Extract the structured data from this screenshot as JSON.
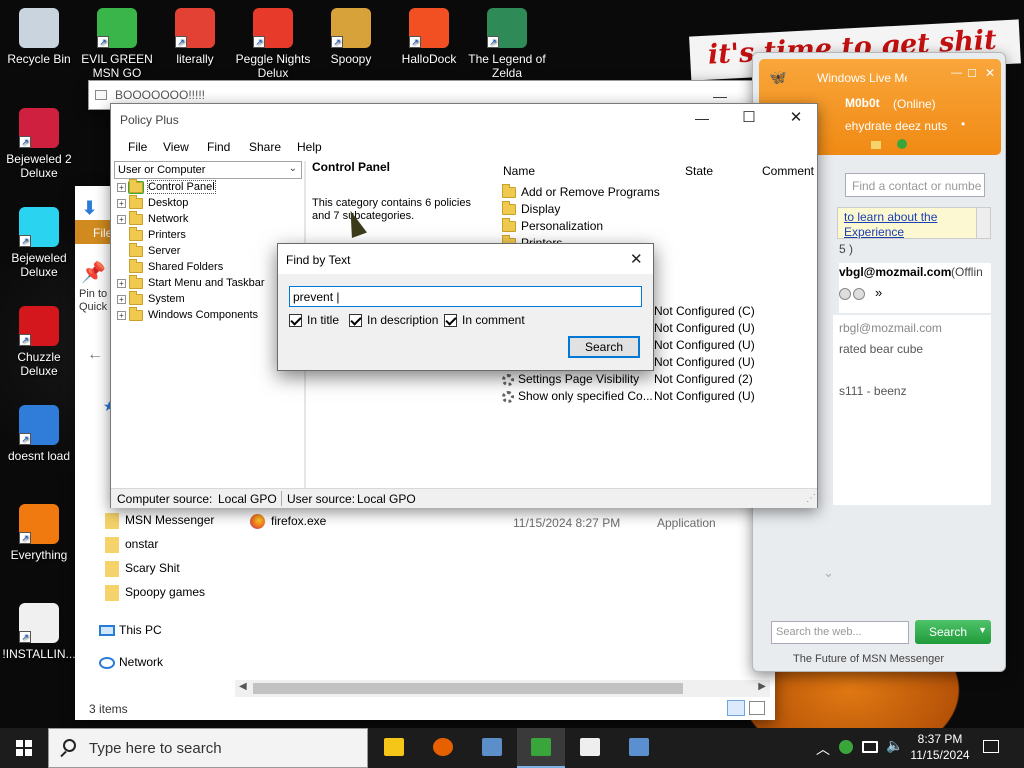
{
  "desktop_icons": [
    {
      "label": "Recycle Bin",
      "icon": "recycle-bin-icon",
      "color": "#c9d4de"
    },
    {
      "label": "EVIL GREEN MSN GO",
      "icon": "msn-buddy-icon",
      "color": "#39b54a"
    },
    {
      "label": "literally",
      "icon": "chrome-icon",
      "color": "#e34133"
    },
    {
      "label": "Peggle Nights Delux",
      "icon": "peggle-icon",
      "color": "#e83a2a"
    },
    {
      "label": "Spoopy",
      "icon": "spoopy-folder-icon",
      "color": "#d8a23b"
    },
    {
      "label": "HalloDock",
      "icon": "windows-logo-icon",
      "color": "#f25022"
    },
    {
      "label": "The Legend of Zelda",
      "icon": "zelda-icon",
      "color": "#2e8b57"
    },
    {
      "label": "Bejeweled 2 Deluxe",
      "icon": "bejeweled2-icon",
      "color": "#d02040"
    },
    {
      "label": "Bejeweled Deluxe",
      "icon": "bejeweled-icon",
      "color": "#2ad4f0"
    },
    {
      "label": "Chuzzle Deluxe",
      "icon": "chuzzle-icon",
      "color": "#d3171d"
    },
    {
      "label": "doesnt load",
      "icon": "thunderbird-icon",
      "color": "#2f7dd8"
    },
    {
      "label": "Everything",
      "icon": "everything-search-icon",
      "color": "#f07a10"
    },
    {
      "label": "!INSTALLIN...",
      "icon": "text-document-icon",
      "color": "#f0f0f0"
    }
  ],
  "banner": {
    "text": "it's time to get shit"
  },
  "boo_window": {
    "title": "BOOOOOOO!!!!!"
  },
  "policy_plus": {
    "title": "Policy Plus",
    "menu": [
      "File",
      "View",
      "Find",
      "Share",
      "Help"
    ],
    "scope_select": "User or Computer",
    "tree": [
      "Control Panel",
      "Desktop",
      "Network",
      "Printers",
      "Server",
      "Shared Folders",
      "Start Menu and Taskbar",
      "System",
      "Windows Components"
    ],
    "detail_heading": "Control Panel",
    "detail_text": "This category contains 6 policies and 7 subcategories.",
    "columns": {
      "name": "Name",
      "state": "State",
      "comment": "Comment"
    },
    "folders": [
      "Add or Remove Programs",
      "Display",
      "Personalization",
      "Printers"
    ],
    "policies": [
      {
        "name": "",
        "state": "Not Configured (C)"
      },
      {
        "name": "",
        "state": "Not Configured (U)"
      },
      {
        "name": "",
        "state": "Not Configured (U)"
      },
      {
        "name": "",
        "state": "Not Configured (U)"
      },
      {
        "name": "Settings Page Visibility",
        "state": "Not Configured (2)"
      },
      {
        "name": "Show only specified Co...",
        "state": "Not Configured (U)"
      }
    ],
    "status": {
      "computer_label": "Computer source:",
      "computer_value": "Local GPO",
      "user_label": "User source:",
      "user_value": "Local GPO"
    }
  },
  "find_dialog": {
    "title": "Find by Text",
    "query": "prevent |",
    "options": [
      {
        "label": "In title",
        "checked": true
      },
      {
        "label": "In description",
        "checked": true
      },
      {
        "label": "In comment",
        "checked": true
      }
    ],
    "search_button": "Search"
  },
  "explorer": {
    "ribbon_file": "File",
    "pin_label": "Pin to Quick access",
    "nav_items": [
      "MSN Messenger",
      "onstar",
      "Scary Shit",
      "Spoopy games"
    ],
    "this_pc": "This PC",
    "network": "Network",
    "file": {
      "name": "firefox.exe",
      "date": "11/15/2024 8:27 PM",
      "type": "Application"
    },
    "status": "3 items"
  },
  "msn": {
    "title": "Windows Live Messenger",
    "user": "M0b0t",
    "status": "(Online)",
    "personal_message": "ehydrate deez nuts",
    "search_contacts_placeholder": "Find a contact or number",
    "info_line1": "to learn about the",
    "info_line2": "Experience",
    "count": "5 )",
    "contact_email": "vbgl@mozmail.com",
    "contact_status": "(Offlin",
    "email2": "rbgl@mozmail.com",
    "line_bear": "rated bear cube",
    "line_beenz": "s111 - beenz",
    "web_search_placeholder": "Search the web...",
    "search_button": "Search",
    "footer": "The Future of MSN Messenger"
  },
  "taskbar": {
    "search_placeholder": "Type here to search",
    "apps": [
      "file-explorer-icon",
      "firefox-icon",
      "policy-plus-icon",
      "msn-messenger-icon",
      "7zip-icon",
      "window-app-icon"
    ],
    "time": "8:37 PM",
    "date": "11/15/2024"
  }
}
